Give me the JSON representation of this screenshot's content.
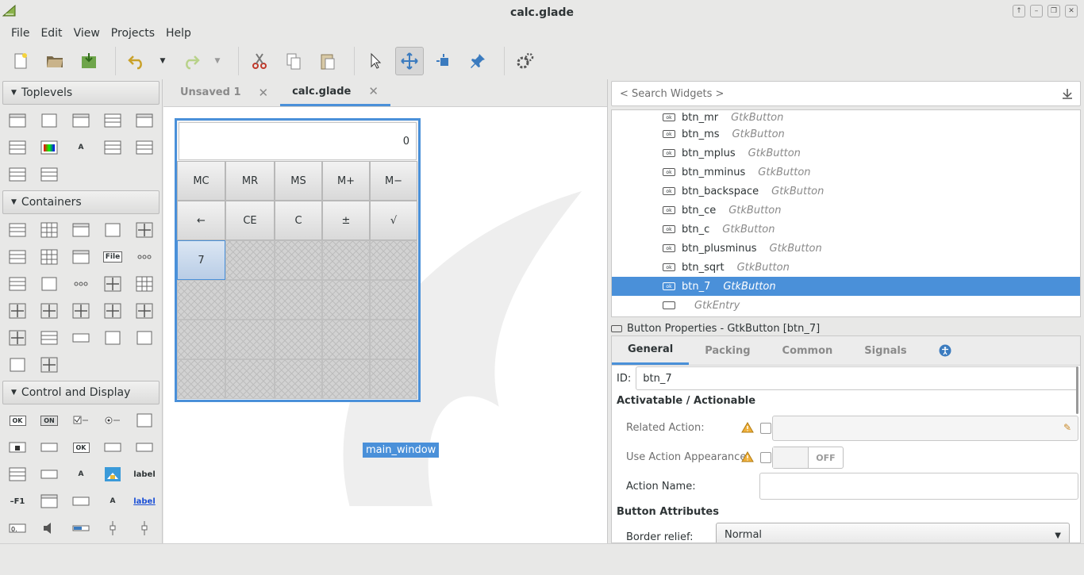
{
  "window": {
    "title": "calc.glade",
    "controls": [
      "minimize",
      "restore",
      "maximize",
      "close"
    ]
  },
  "menu": [
    "File",
    "Edit",
    "View",
    "Projects",
    "Help"
  ],
  "palette": {
    "sections": [
      {
        "label": "Toplevels",
        "count": 12
      },
      {
        "label": "Containers",
        "count": 27
      },
      {
        "label": "Control and Display",
        "count": 25
      }
    ],
    "icon_texts": {
      "ok": "OK",
      "on": "ON",
      "file": "File",
      "a": "A",
      "label": "label",
      "f1": "F1"
    }
  },
  "tabs": [
    {
      "label": "Unsaved 1",
      "active": false
    },
    {
      "label": "calc.glade",
      "active": true
    }
  ],
  "calc": {
    "display_value": "0",
    "row1": [
      "MC",
      "MR",
      "MS",
      "M+",
      "M−"
    ],
    "row2": [
      "←",
      "CE",
      "C",
      "±",
      "√"
    ],
    "selected_button": "7",
    "window_label": "main_window"
  },
  "search_placeholder": "< Search Widgets >",
  "inspector": [
    {
      "name": "btn_mr",
      "type": "GtkButton"
    },
    {
      "name": "btn_ms",
      "type": "GtkButton"
    },
    {
      "name": "btn_mplus",
      "type": "GtkButton"
    },
    {
      "name": "btn_mminus",
      "type": "GtkButton"
    },
    {
      "name": "btn_backspace",
      "type": "GtkButton"
    },
    {
      "name": "btn_ce",
      "type": "GtkButton"
    },
    {
      "name": "btn_c",
      "type": "GtkButton"
    },
    {
      "name": "btn_plusminus",
      "type": "GtkButton"
    },
    {
      "name": "btn_sqrt",
      "type": "GtkButton"
    },
    {
      "name": "btn_7",
      "type": "GtkButton",
      "selected": true
    },
    {
      "name": "",
      "type": "GtkEntry"
    }
  ],
  "properties": {
    "header": "Button Properties - GtkButton [btn_7]",
    "tabs": [
      "General",
      "Packing",
      "Common",
      "Signals"
    ],
    "id_label": "ID:",
    "id_value": "btn_7",
    "section1": "Activatable / Actionable",
    "related_action": "Related Action:",
    "use_action_appearance": "Use Action Appearance:",
    "toggle_state": "OFF",
    "action_name": "Action Name:",
    "section2": "Button Attributes",
    "border_relief": "Border relief:",
    "border_relief_value": "Normal"
  },
  "colors": {
    "accent": "#4a90d9",
    "window_bg": "#e8e8e7"
  }
}
